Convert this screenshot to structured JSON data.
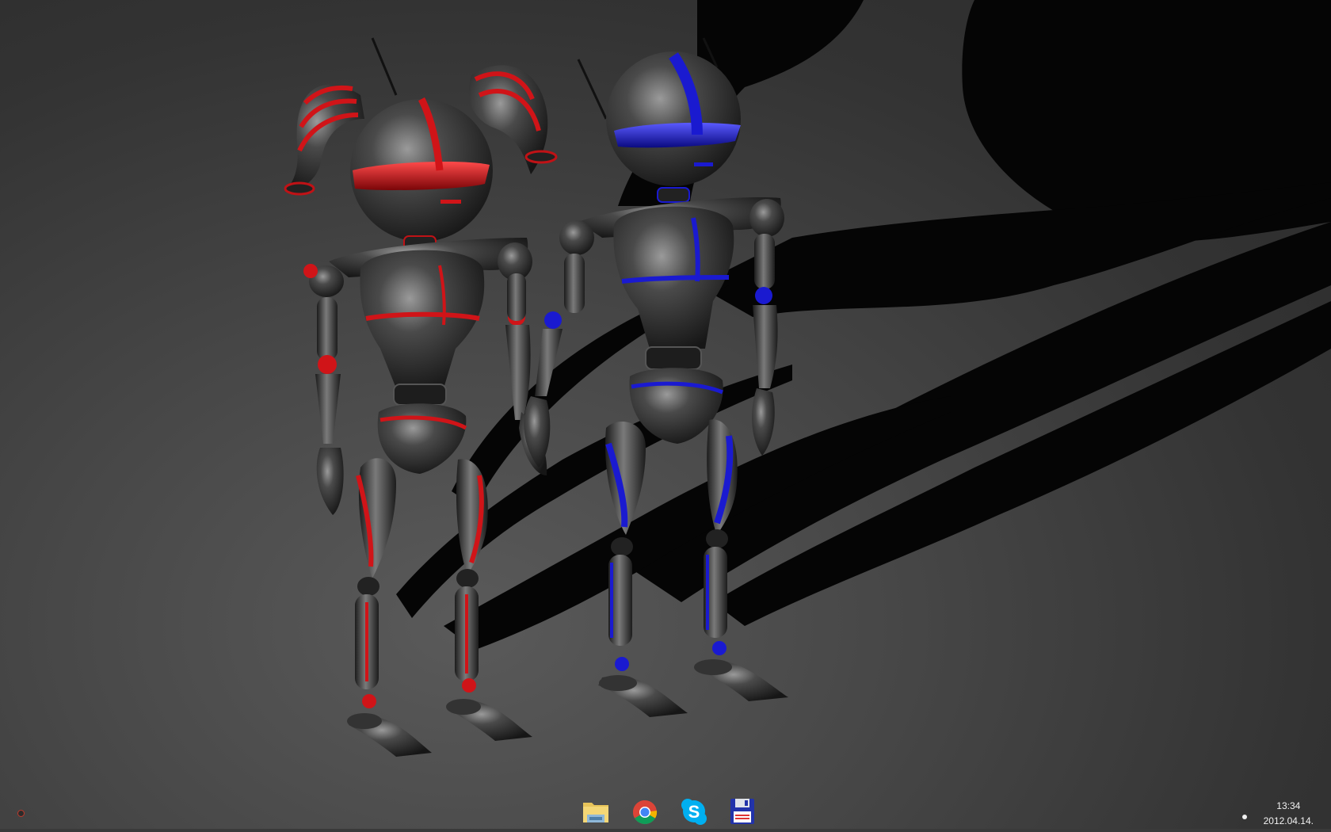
{
  "desktop": {
    "wallpaper": "robots-wallpaper",
    "colors": {
      "accent_left": "#c8141b",
      "accent_right": "#1a1ad0"
    }
  },
  "taskbar": {
    "start": {
      "icon": "start-orb-icon"
    },
    "apps": [
      {
        "name": "Windows Explorer",
        "icon": "folder-icon",
        "active": false
      },
      {
        "name": "Google Chrome",
        "icon": "chrome-icon",
        "active": false
      },
      {
        "name": "Skype",
        "icon": "skype-icon",
        "active": true
      },
      {
        "name": "Save",
        "icon": "floppy-disk-icon",
        "active": false
      }
    ],
    "active_indicator_color": "#d64b3a",
    "tray": {
      "time": "13:34",
      "date": "2012.04.14."
    }
  }
}
